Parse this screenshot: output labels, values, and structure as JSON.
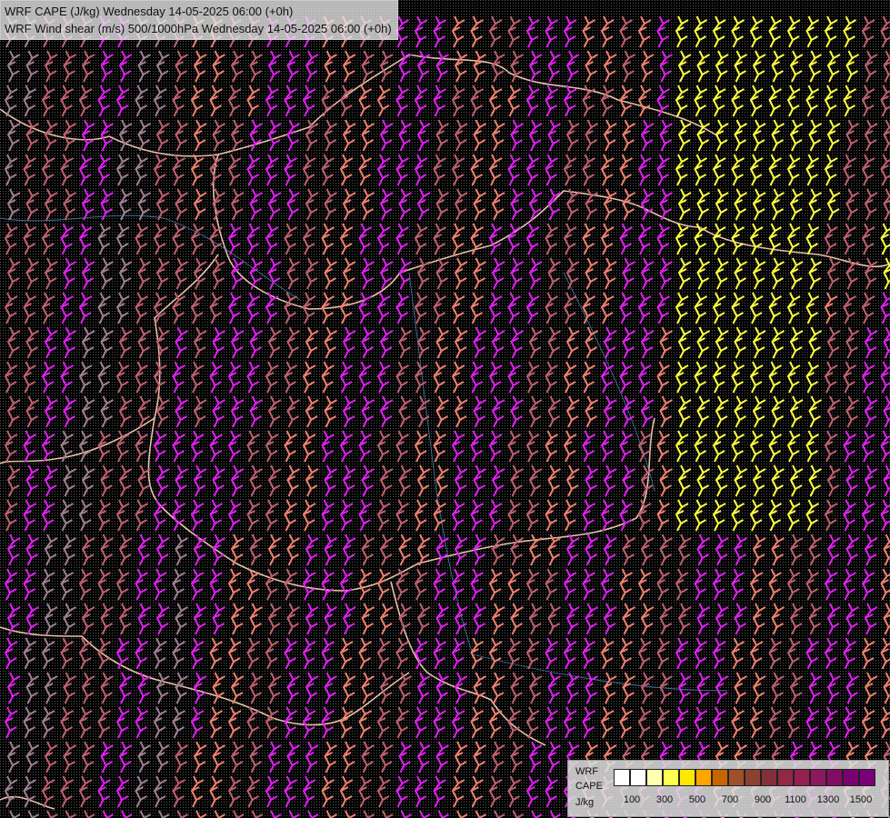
{
  "header": {
    "line1": "WRF CAPE (J/kg) Wednesday 14-05-2025 06:00 (+0h)",
    "line2": "WRF Wind shear (m/s) 500/1000hPa Wednesday 14-05-2025 06:00 (+0h)"
  },
  "legend": {
    "label1": "WRF",
    "label2": "CAPE",
    "label3": "J/kg",
    "colors": [
      "#ffffff",
      "#ffffff",
      "#ffffb0",
      "#ffff50",
      "#ffe800",
      "#ffa500",
      "#c86400",
      "#a05028",
      "#8c4030",
      "#84303a",
      "#902846",
      "#961e50",
      "#8c1860",
      "#820c64",
      "#780070",
      "#7a0078"
    ],
    "ticks": [
      "100",
      "300",
      "500",
      "700",
      "900",
      "1100",
      "1300",
      "1500"
    ]
  },
  "map": {
    "background": "#000000",
    "barb_colors": {
      "low": "#c06070",
      "mid": "#e060c0",
      "magenta": "#e020f0",
      "salmon": "#f08070",
      "yellow": "#ffff40",
      "grey": "#a08090"
    },
    "border_color": "#e8c0a8",
    "river_color": "#5090c0"
  }
}
